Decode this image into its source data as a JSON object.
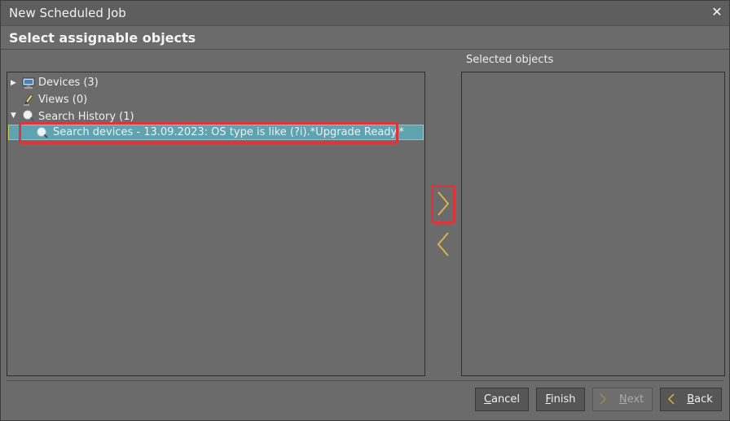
{
  "window": {
    "title": "New Scheduled Job"
  },
  "header": {
    "title": "Select assignable objects"
  },
  "right_panel": {
    "label": "Selected objects"
  },
  "tree": {
    "items": [
      {
        "label": "Devices (3)",
        "icon": "monitor-icon",
        "expanded": false
      },
      {
        "label": "Views (0)",
        "icon": "pencil-icon"
      },
      {
        "label": "Search History (1)",
        "icon": "search-history-icon",
        "expanded": true
      },
      {
        "label": "Search devices - 13.09.2023: OS type is like (?i).*Upgrade Ready.*",
        "icon": "search-icon",
        "selected": true
      }
    ]
  },
  "buttons": {
    "cancel": {
      "underline": "C",
      "rest": "ancel"
    },
    "finish": {
      "underline": "F",
      "rest": "inish"
    },
    "next": {
      "underline": "N",
      "rest": "ext"
    },
    "back": {
      "underline": "B",
      "rest": "ack"
    }
  },
  "colors": {
    "accent_arrow": "#d8b24a",
    "selection_bg": "#5fa3b0",
    "highlight": "#e0343a"
  }
}
